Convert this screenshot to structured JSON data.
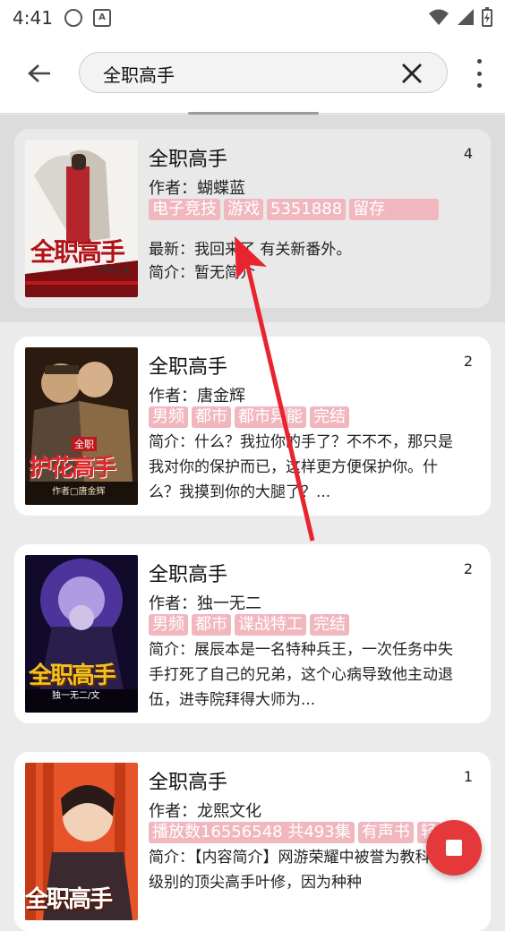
{
  "status_bar": {
    "time": "4:41",
    "icon_left_1": "music-note-icon",
    "icon_left_2": "A",
    "icons_right": [
      "wifi-icon",
      "signal-icon",
      "battery-icon"
    ]
  },
  "app_bar": {
    "search_value": "全职高手",
    "back_icon": "back-arrow-icon",
    "clear_icon": "close-icon",
    "more_icon": "more-vert-icon"
  },
  "results": [
    {
      "title": "全职高手",
      "rank": "4",
      "author": "作者：蝴蝶蓝",
      "tags": [
        "电子竞技",
        "游戏",
        "5351888",
        "留存"
      ],
      "latest": "最新：我回来了 有关新番外。",
      "intro": "简介：暂无简介",
      "cover_title": "全职高手",
      "cover_author": "蝴蝶蓝 著"
    },
    {
      "title": "全职高手",
      "rank": "2",
      "author": "作者：唐金辉",
      "tags": [
        "男频",
        "都市",
        "都市异能",
        "完结"
      ],
      "intro": "简介：什么？我拉你的手了？不不不，那只是我对你的保护而已，这样更方便保护你。什么？我摸到你的大腿了？...",
      "cover_title": "护花高手",
      "cover_sub": "全职",
      "cover_author": "作者□唐金辉"
    },
    {
      "title": "全职高手",
      "rank": "2",
      "author": "作者：独一无二",
      "tags": [
        "男频",
        "都市",
        "谍战特工",
        "完结"
      ],
      "intro": "简介：展辰本是一名特种兵王，一次任务中失手打死了自己的兄弟，这个心病导致他主动退伍，进寺院拜得大师为...",
      "cover_title": "全职高手",
      "cover_author": "独一无二/文"
    },
    {
      "title": "全职高手",
      "rank": "1",
      "author": "作者：龙熙文化",
      "tags": [
        "播放数16556548 共493集",
        "有声书",
        "轻"
      ],
      "intro": "简介：【内容简介】网游荣耀中被誉为教科书级别的顶尖高手叶修，因为种种",
      "cover_title": "全职高手"
    }
  ],
  "fab": {
    "icon": "stop-icon"
  },
  "colors": {
    "tag_bg": "#f1b7bf",
    "fab": "#e5383b",
    "arrow": "#e8252f"
  }
}
